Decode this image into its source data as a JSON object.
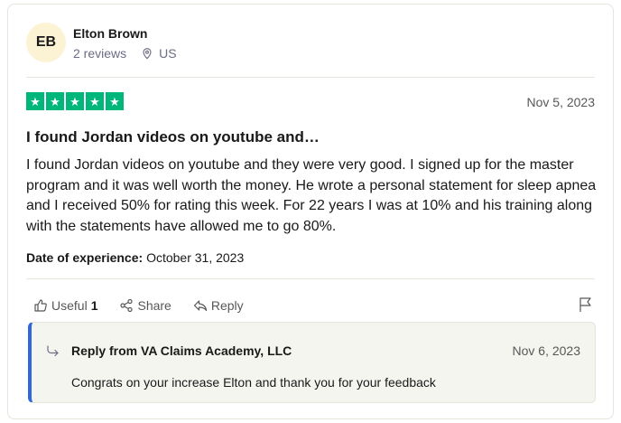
{
  "reviewer": {
    "initials": "EB",
    "name": "Elton Brown",
    "reviews": "2 reviews",
    "country": "US"
  },
  "review": {
    "rating": 5,
    "date": "Nov 5, 2023",
    "title": "I found Jordan videos on youtube and…",
    "body": "I found Jordan videos on youtube and they were very good. I signed up for the master program and it was well worth the money. He wrote a personal statement for sleep apnea and I received 50% for rating this week. For 22 years I was at 10% and his training along with the statements have allowed me to go 80%.",
    "experience_label": "Date of experience:",
    "experience_date": "October 31, 2023"
  },
  "actions": {
    "useful_label": "Useful",
    "useful_count": "1",
    "share_label": "Share",
    "reply_label": "Reply"
  },
  "reply": {
    "title": "Reply from VA Claims Academy, LLC",
    "date": "Nov 6, 2023",
    "text": "Congrats on your increase Elton and thank you for your feedback"
  },
  "colors": {
    "star_green": "#00b67a",
    "reply_accent": "#3067dd",
    "avatar_bg": "#fcf3d4"
  },
  "icons": [
    "map-pin-icon",
    "star-icon",
    "thumbs-up-icon",
    "share-icon",
    "reply-arrow-icon",
    "flag-icon",
    "reply-indent-icon"
  ]
}
